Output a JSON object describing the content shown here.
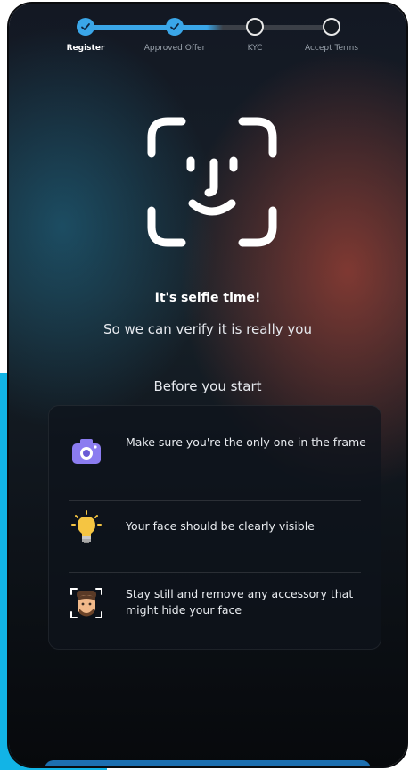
{
  "stepper": {
    "steps": [
      {
        "label": "Register",
        "state": "done"
      },
      {
        "label": "Approved Offer",
        "state": "done"
      },
      {
        "label": "KYC",
        "state": "todo"
      },
      {
        "label": "Accept Terms",
        "state": "todo"
      }
    ],
    "active_index": 0
  },
  "hero": {
    "icon": "face-scan-icon",
    "title": "It's selfie time!",
    "subtitle": "So we can verify it is really you"
  },
  "tips": {
    "heading": "Before you start",
    "items": [
      {
        "icon": "camera-icon",
        "text": "Make sure you're the only one in the frame"
      },
      {
        "icon": "lightbulb-icon",
        "text": "Your face should be clearly visible"
      },
      {
        "icon": "face-frame-icon",
        "text": "Stay still and remove any accessory that might hide your face"
      }
    ]
  },
  "colors": {
    "accent": "#3aa6e8",
    "side_accent": "#12b4e6",
    "camera_icon": "#8b7cf0",
    "bulb": "#f5c542"
  }
}
